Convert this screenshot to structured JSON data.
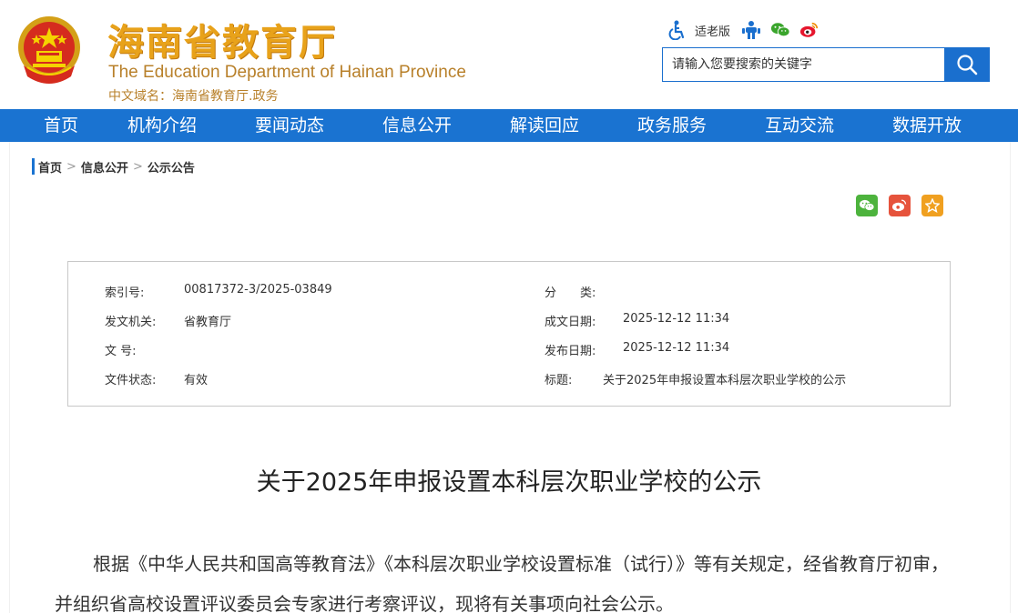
{
  "header": {
    "title": "海南省教育厅",
    "subtitle": "The Education Department of Hainan Province",
    "domain": "中文域名：海南省教育厅.政务"
  },
  "tools": {
    "elder_label": "适老版"
  },
  "search": {
    "placeholder": "请输入您要搜索的关键字"
  },
  "nav": {
    "items": [
      "首页",
      "机构介绍",
      "要闻动态",
      "信息公开",
      "解读回应",
      "政务服务",
      "互动交流",
      "数据开放"
    ]
  },
  "breadcrumb": {
    "items": [
      "首页",
      "信息公开",
      "公示公告"
    ],
    "separator": ">"
  },
  "meta": {
    "index_label": "索引号:",
    "index_value": "00817372-3/2025-03849",
    "category_label": "分　　类:",
    "category_value": "",
    "issuer_label": "发文机关:",
    "issuer_value": "省教育厅",
    "created_label": "成文日期:",
    "created_value": "2025-12-12 11:34",
    "docno_label": "文  号:",
    "docno_value": "",
    "published_label": "发布日期:",
    "published_value": "2025-12-12 11:34",
    "status_label": "文件状态:",
    "status_value": "有效",
    "subject_label": "标题:",
    "subject_value": "关于2025年申报设置本科层次职业学校的公示"
  },
  "article": {
    "title": "关于2025年申报设置本科层次职业学校的公示",
    "paragraph": "根据《中华人民共和国高等教育法》《本科层次职业学校设置标准（试行）》等有关规定，经省教育厅初审，并组织省高校设置评议委员会专家进行考察评议，现将有关事项向社会公示。"
  },
  "colors": {
    "nav_blue": "#1a73d1",
    "title_gold": "#e8a21a",
    "subtitle_gold": "#b8802a",
    "wechat_green": "#4db33d",
    "weibo_red": "#e6533c",
    "favorite_orange": "#f0a020"
  },
  "icons": [
    "national-emblem-icon",
    "accessibility-icon",
    "elder-mode-icon",
    "wechat-icon",
    "weibo-icon",
    "search-icon",
    "favorite-star-icon"
  ]
}
